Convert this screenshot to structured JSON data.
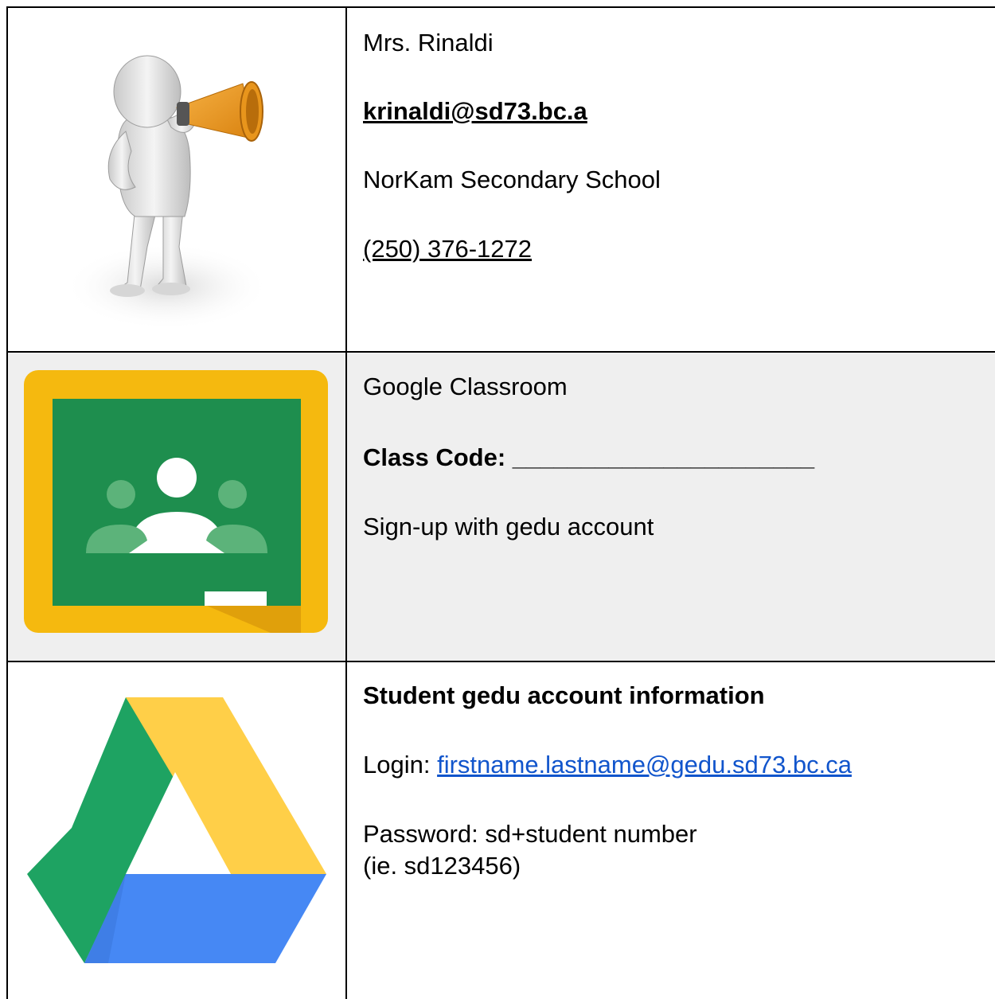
{
  "contact": {
    "teacher_name": "Mrs. Rinaldi",
    "email": "krinaldi@sd73.bc.a",
    "school": "NorKam Secondary School",
    "phone": "(250) 376-1272",
    "illustration_icon": "megaphone-person-icon"
  },
  "classroom": {
    "title": "Google Classroom",
    "class_code_label": "Class Code: ",
    "class_code_blank": "______________________",
    "signup_note": "Sign-up with gedu account",
    "icon": "google-classroom-icon",
    "colors": {
      "frame": "#f5b90f",
      "board": "#1e8e4e",
      "people": "#ffffff"
    }
  },
  "account": {
    "heading": "Student gedu account information",
    "login_label": "Login: ",
    "login_value": "firstname.lastname@gedu.sd73.bc.ca",
    "password_line": "Password: sd+student number",
    "password_example": "(ie. sd123456)",
    "icon": "google-drive-icon",
    "colors": {
      "green": "#1ea362",
      "yellow": "#ffcf48",
      "blue": "#4688f4",
      "link": "#1155cc"
    }
  }
}
